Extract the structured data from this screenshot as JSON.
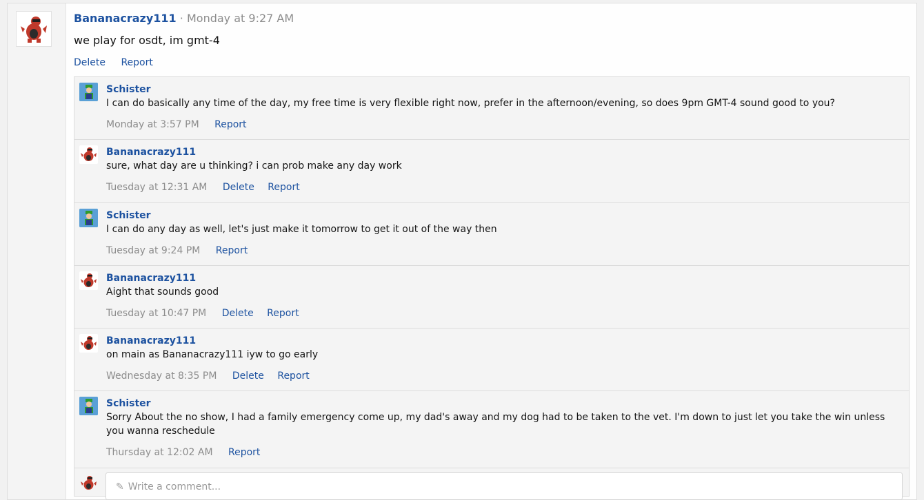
{
  "post": {
    "author": "Bananacrazy111",
    "separator": "·",
    "time": "Monday at 9:27 AM",
    "text": "we play for osdt, im gmt-4",
    "actions": {
      "delete": "Delete",
      "report": "Report"
    }
  },
  "comments": [
    {
      "author": "Schister",
      "avatar": "luigi-avatar",
      "text": "I can do basically any time of the day, my free time is very flexible right now, prefer in the afternoon/evening, so does 9pm GMT-4 sound good to you?",
      "time": "Monday at 3:57 PM",
      "report": "Report"
    },
    {
      "author": "Bananacrazy111",
      "avatar": "krookodile-avatar",
      "text": "sure, what day are u thinking? i can prob make any day work",
      "time": "Tuesday at 12:31 AM",
      "delete": "Delete",
      "report": "Report"
    },
    {
      "author": "Schister",
      "avatar": "luigi-avatar",
      "text": "I can do any day as well, let's just make it tomorrow to get it out of the way then",
      "time": "Tuesday at 9:24 PM",
      "report": "Report"
    },
    {
      "author": "Bananacrazy111",
      "avatar": "krookodile-avatar",
      "text": "Aight that sounds good",
      "time": "Tuesday at 10:47 PM",
      "delete": "Delete",
      "report": "Report"
    },
    {
      "author": "Bananacrazy111",
      "avatar": "krookodile-avatar",
      "text": "on main as Bananacrazy111 iyw to go early",
      "time": "Wednesday at 8:35 PM",
      "delete": "Delete",
      "report": "Report"
    },
    {
      "author": "Schister",
      "avatar": "luigi-avatar",
      "text": "Sorry About the no show, I had a family emergency come up, my dad's away and my dog had to be taken to the vet. I'm down to just let you take the win unless you wanna reschedule",
      "time": "Thursday at 12:02 AM",
      "report": "Report"
    }
  ],
  "reply": {
    "placeholder": "Write a comment...",
    "icon": "pencil-icon"
  },
  "colors": {
    "link": "#1d52a0",
    "muted": "#8c8c8c",
    "comment_bg": "#f4f4f4"
  }
}
